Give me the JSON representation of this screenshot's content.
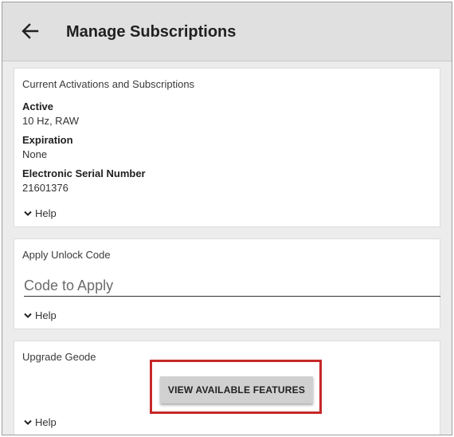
{
  "header": {
    "title": "Manage Subscriptions"
  },
  "current": {
    "section_title": "Current Activations and Subscriptions",
    "active_label": "Active",
    "active_value": "10 Hz, RAW",
    "expiration_label": "Expiration",
    "expiration_value": "None",
    "esn_label": "Electronic Serial Number",
    "esn_value": "21601376",
    "help_label": "Help"
  },
  "unlock": {
    "section_title": "Apply Unlock Code",
    "placeholder": "Code to Apply",
    "value": "",
    "help_label": "Help"
  },
  "upgrade": {
    "section_title": "Upgrade Geode",
    "button_label": "VIEW AVAILABLE FEATURES",
    "help_label": "Help"
  },
  "colors": {
    "appbar_bg": "#e0e0e0",
    "background": "#ececec",
    "highlight_border": "#c62828",
    "button_bg": "#d0d0d0"
  },
  "icons": {
    "back": "arrow-left",
    "help_toggle": "chevron-down"
  }
}
